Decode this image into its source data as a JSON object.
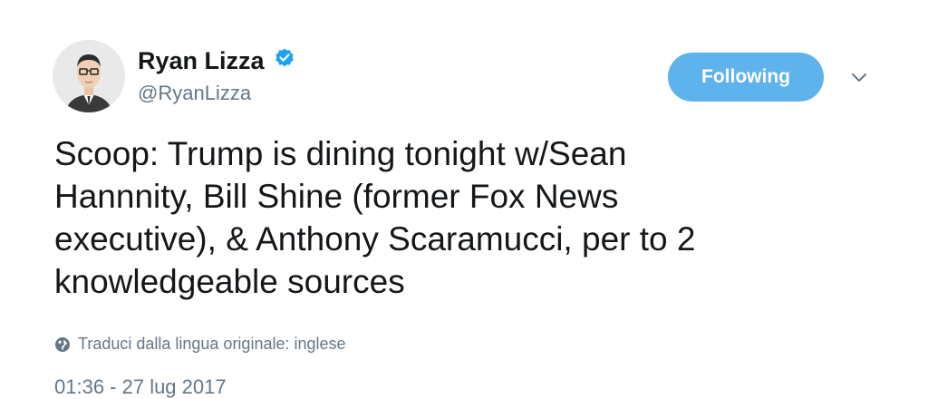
{
  "user": {
    "display_name": "Ryan Lizza",
    "handle": "@RyanLizza",
    "verified": true,
    "verified_icon": "verified-badge-icon"
  },
  "actions": {
    "follow_label": "Following",
    "more_icon": "chevron-down-icon"
  },
  "tweet": {
    "lines": [
      "Scoop: Trump is dining tonight w/Sean",
      "Hannnity, Bill Shine (former Fox News",
      "executive), & Anthony Scaramucci, per to 2",
      "knowledgeable sources"
    ],
    "translate_label": "Traduci dalla lingua originale: inglese",
    "translate_icon": "globe-icon",
    "timestamp": "01:36 - 27 lug 2017"
  },
  "colors": {
    "accent": "#5fb3ec",
    "verified": "#1da1f2",
    "secondary_text": "#657786",
    "primary_text": "#14171a"
  }
}
